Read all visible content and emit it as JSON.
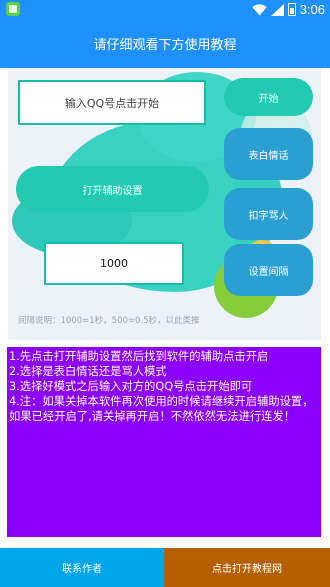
{
  "status_bar": {
    "time": "3:06"
  },
  "app_bar": {
    "title": "请仔细观看下方使用教程"
  },
  "form": {
    "qq_placeholder": "输入QQ号点击开始",
    "interval_value": "1000",
    "interval_hint": "间隔说明：1000=1秒，500=0.5秒，以此类推"
  },
  "buttons": {
    "start": "开始",
    "confess": "表白情话",
    "curse": "扣字骂人",
    "open_accessibility": "打开辅助设置",
    "set_interval": "设置间隔"
  },
  "instructions": [
    "1.先点击打开辅助设置然后找到软件的辅助点击开启",
    "2.选择是表白情话还是骂人模式",
    "3.选择好模式之后输入对方的QQ号点击开始即可",
    " 4.注：如果关掉本软件再次使用的时候请继续开启辅助设置，如果已经开启了,请关掉再开启！不然依然无法进行连发！"
  ],
  "footer": {
    "contact": "联系作者",
    "tutorial": "点击打开教程网"
  },
  "colors": {
    "primary": "#1e90ff",
    "teal": "#22c9b3",
    "blue_button": "#2a9fd2",
    "purple_panel": "#8c00ff",
    "footer_left": "#00a6e8",
    "footer_right": "#b45f00"
  }
}
